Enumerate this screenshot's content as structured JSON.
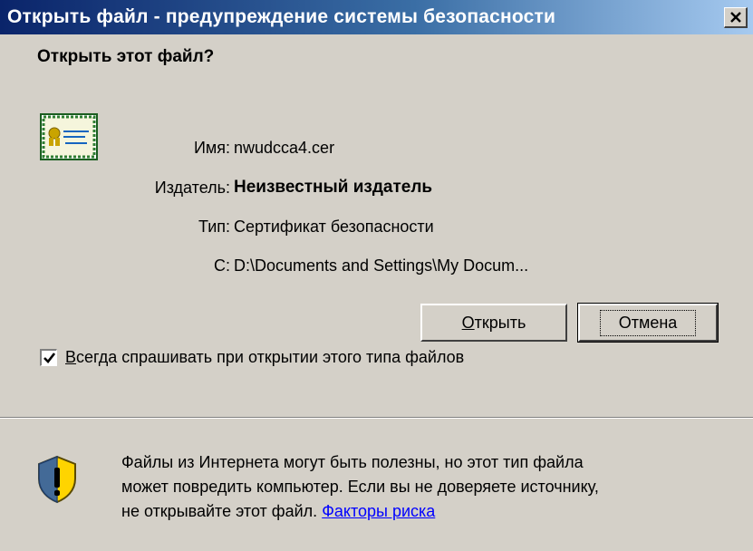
{
  "window": {
    "title": "Открыть файл - предупреждение системы безопасности",
    "close_glyph": "✕"
  },
  "dialog": {
    "heading": "Открыть этот файл?",
    "icon": "certificate-icon",
    "fields": {
      "name_label": "Имя:",
      "name_value": "nwudcca4.cer",
      "publisher_label": "Издатель:",
      "publisher_value": "Неизвестный издатель",
      "type_label": "Тип:",
      "type_value": "Сертификат безопасности",
      "from_label": "С:",
      "from_value": "D:\\Documents and Settings\\My Docum..."
    },
    "buttons": {
      "open_label_accel": "О",
      "open_label_rest": "ткрыть",
      "cancel_label": "Отмена"
    },
    "checkbox": {
      "checked": true,
      "label_accel": "В",
      "label_rest": "сегда спрашивать при открытии этого типа файлов"
    }
  },
  "warning": {
    "icon": "shield-warning-icon",
    "text_line1": "Файлы из Интернета могут быть полезны, но этот тип файла",
    "text_line2": "может повредить компьютер. Если вы не доверяете источнику,",
    "text_line3_prefix": "не открывайте этот файл. ",
    "risk_link": "Факторы риска"
  },
  "colors": {
    "titlebar_start": "#0a246a",
    "titlebar_end": "#a6caf0",
    "dialog_bg": "#d4d0c8",
    "link": "#0000ff"
  }
}
